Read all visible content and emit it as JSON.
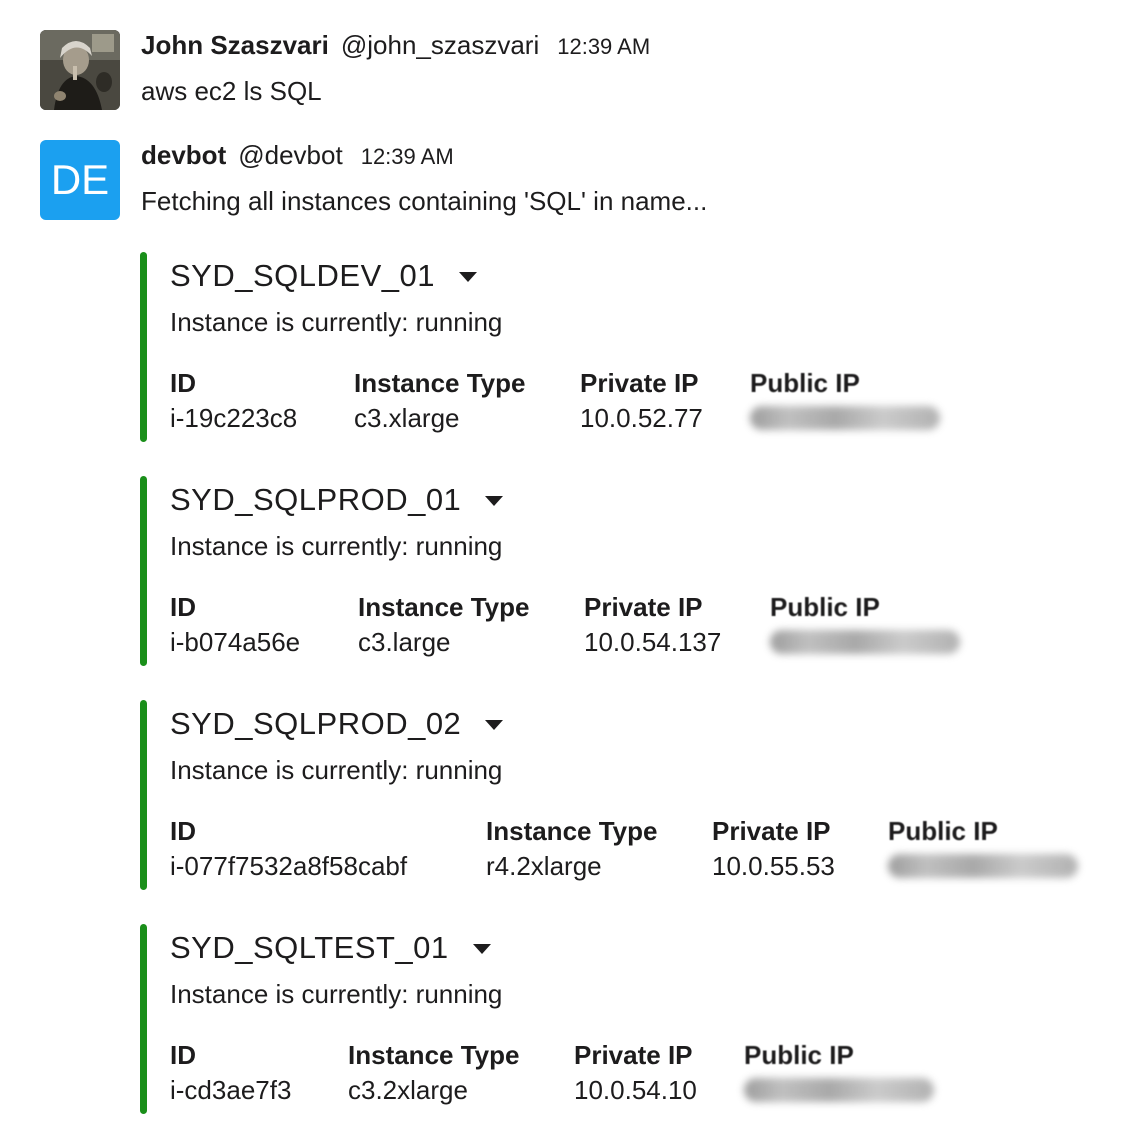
{
  "messages": [
    {
      "sender": "John Szaszvari",
      "handle": "@john_szaszvari",
      "time": "12:39 AM",
      "avatar_icon": "user-photo-avatar",
      "text": "aws ec2 ls SQL"
    },
    {
      "sender": "devbot",
      "handle": "@devbot",
      "time": "12:39 AM",
      "avatar_initials": "DE",
      "avatar_color": "#1ba0f0",
      "text": "Fetching all instances containing 'SQL' in name..."
    }
  ],
  "labels": {
    "id": "ID",
    "instance_type": "Instance Type",
    "private_ip": "Private IP",
    "public_ip": "Public IP"
  },
  "instances": [
    {
      "name": "SYD_SQLDEV_01",
      "status": "Instance is currently: running",
      "id": "i-19c223c8",
      "type": "c3.xlarge",
      "private_ip": "10.0.52.77",
      "public_ip_redacted": true
    },
    {
      "name": "SYD_SQLPROD_01",
      "status": "Instance is currently: running",
      "id": "i-b074a56e",
      "type": "c3.large",
      "private_ip": "10.0.54.137",
      "public_ip_redacted": true
    },
    {
      "name": "SYD_SQLPROD_02",
      "status": "Instance is currently: running",
      "id": "i-077f7532a8f58cabf",
      "type": "r4.2xlarge",
      "private_ip": "10.0.55.53",
      "public_ip_redacted": true
    },
    {
      "name": "SYD_SQLTEST_01",
      "status": "Instance is currently: running",
      "id": "i-cd3ae7f3",
      "type": "c3.2xlarge",
      "private_ip": "10.0.54.10",
      "public_ip_redacted": true
    }
  ],
  "colors": {
    "attachment_bar": "#1a8f1a",
    "text": "#1d1c1d"
  }
}
